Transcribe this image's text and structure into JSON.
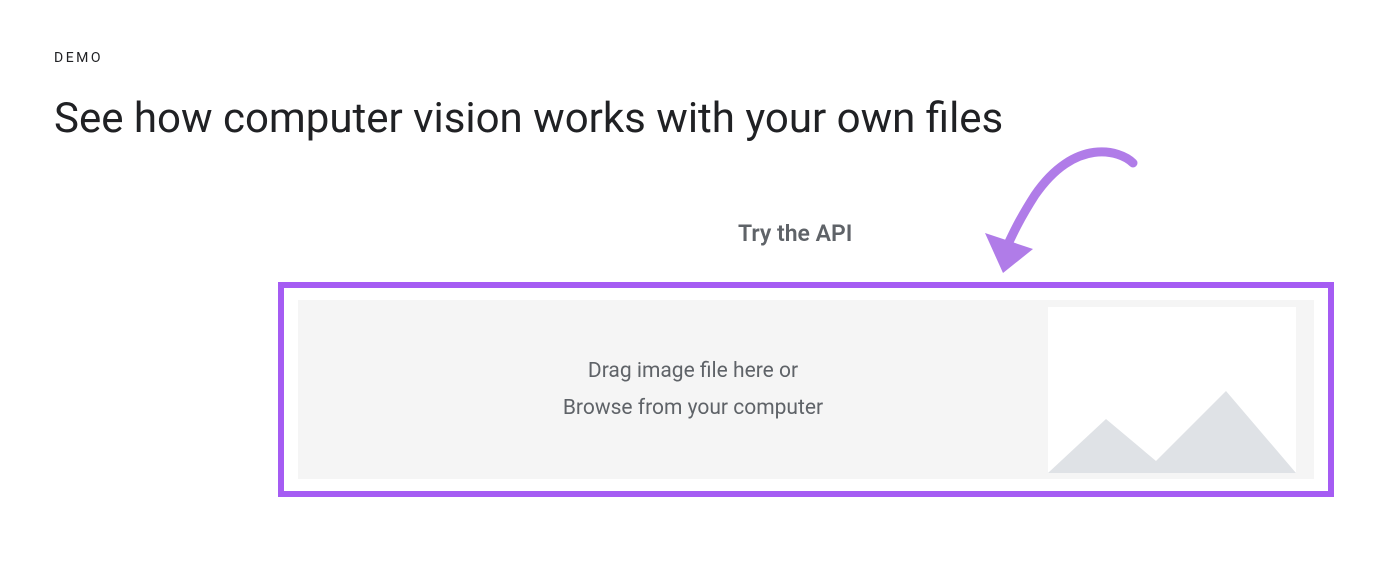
{
  "eyebrow": "DEMO",
  "headline": "See how computer vision works with your own files",
  "try_label": "Try the API",
  "dropzone": {
    "line1": "Drag image file here or",
    "line2": "Browse from your computer"
  },
  "colors": {
    "accent": "#a55cf3",
    "text_primary": "#202124",
    "text_secondary": "#5f6368",
    "placeholder_fill": "#dfe2e6",
    "dropzone_bg": "#f5f5f5"
  }
}
